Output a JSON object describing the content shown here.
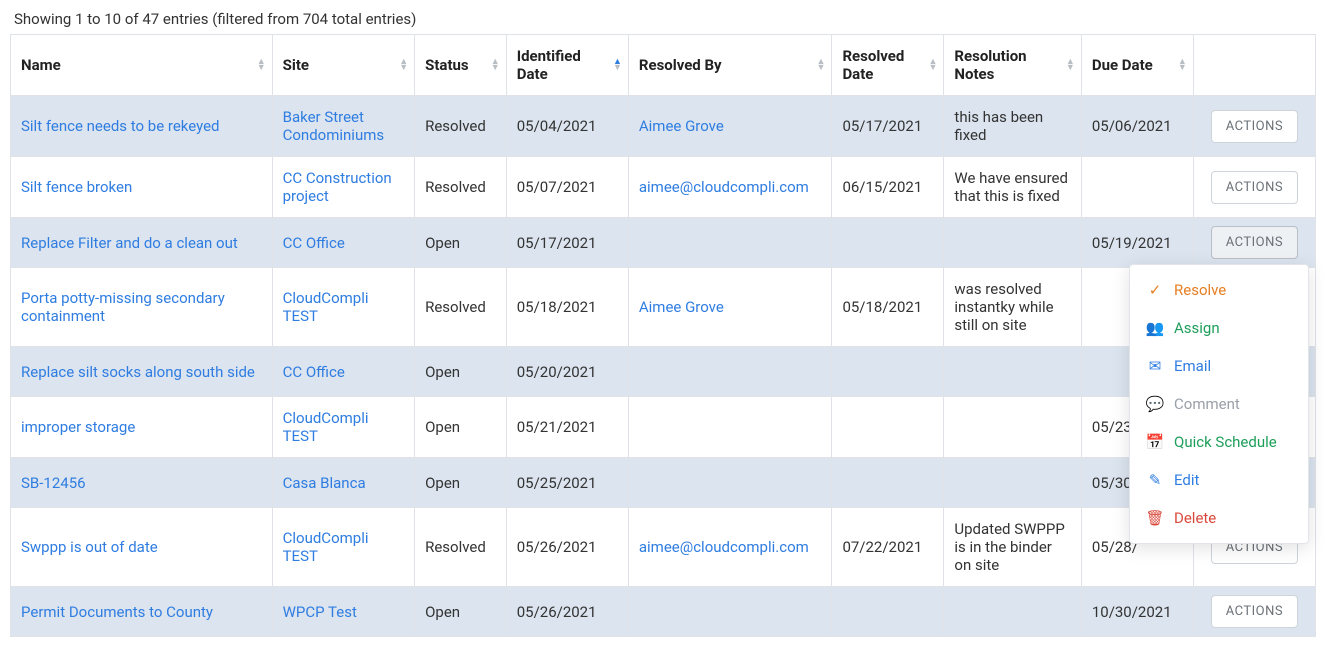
{
  "info_text": "Showing 1 to 10 of 47 entries (filtered from 704 total entries)",
  "columns": {
    "name": "Name",
    "site": "Site",
    "status": "Status",
    "identified": "Identified Date",
    "resolved_by": "Resolved By",
    "resolved_date": "Resolved Date",
    "notes": "Resolution Notes",
    "due": "Due Date"
  },
  "actions_label": "ACTIONS",
  "dropdown": {
    "resolve": "Resolve",
    "assign": "Assign",
    "email": "Email",
    "comment": "Comment",
    "quick_schedule": "Quick Schedule",
    "edit": "Edit",
    "delete": "Delete"
  },
  "rows": [
    {
      "name": "Silt fence needs to be rekeyed",
      "site": "Baker Street Condominiums",
      "status": "Resolved",
      "identified": "05/04/2021",
      "resolved_by": "Aimee Grove",
      "resolved_date": "05/17/2021",
      "notes": "this has been fixed",
      "due": "05/06/2021"
    },
    {
      "name": "Silt fence broken",
      "site": "CC Construction project",
      "status": "Resolved",
      "identified": "05/07/2021",
      "resolved_by": "aimee@cloudcompli.com",
      "resolved_date": "06/15/2021",
      "notes": "We have ensured that this is fixed",
      "due": ""
    },
    {
      "name": "Replace Filter and do a clean out",
      "site": "CC Office",
      "status": "Open",
      "identified": "05/17/2021",
      "resolved_by": "",
      "resolved_date": "",
      "notes": "",
      "due": "05/19/2021"
    },
    {
      "name": "Porta potty-missing secondary containment",
      "site": "CloudCompli TEST",
      "status": "Resolved",
      "identified": "05/18/2021",
      "resolved_by": "Aimee Grove",
      "resolved_date": "05/18/2021",
      "notes": "was resolved instantky while still on site",
      "due": ""
    },
    {
      "name": "Replace silt socks along south side",
      "site": "CC Office",
      "status": "Open",
      "identified": "05/20/2021",
      "resolved_by": "",
      "resolved_date": "",
      "notes": "",
      "due": ""
    },
    {
      "name": "improper storage",
      "site": "CloudCompli TEST",
      "status": "Open",
      "identified": "05/21/2021",
      "resolved_by": "",
      "resolved_date": "",
      "notes": "",
      "due": "05/23/"
    },
    {
      "name": "SB-12456",
      "site": "Casa Blanca",
      "status": "Open",
      "identified": "05/25/2021",
      "resolved_by": "",
      "resolved_date": "",
      "notes": "",
      "due": "05/30/"
    },
    {
      "name": "Swppp is out of date",
      "site": "CloudCompli TEST",
      "status": "Resolved",
      "identified": "05/26/2021",
      "resolved_by": "aimee@cloudcompli.com",
      "resolved_date": "07/22/2021",
      "notes": "Updated SWPPP is in the binder on site",
      "due": "05/28/"
    },
    {
      "name": "Permit Documents to County",
      "site": "WPCP Test",
      "status": "Open",
      "identified": "05/26/2021",
      "resolved_by": "",
      "resolved_date": "",
      "notes": "",
      "due": "10/30/2021"
    }
  ]
}
